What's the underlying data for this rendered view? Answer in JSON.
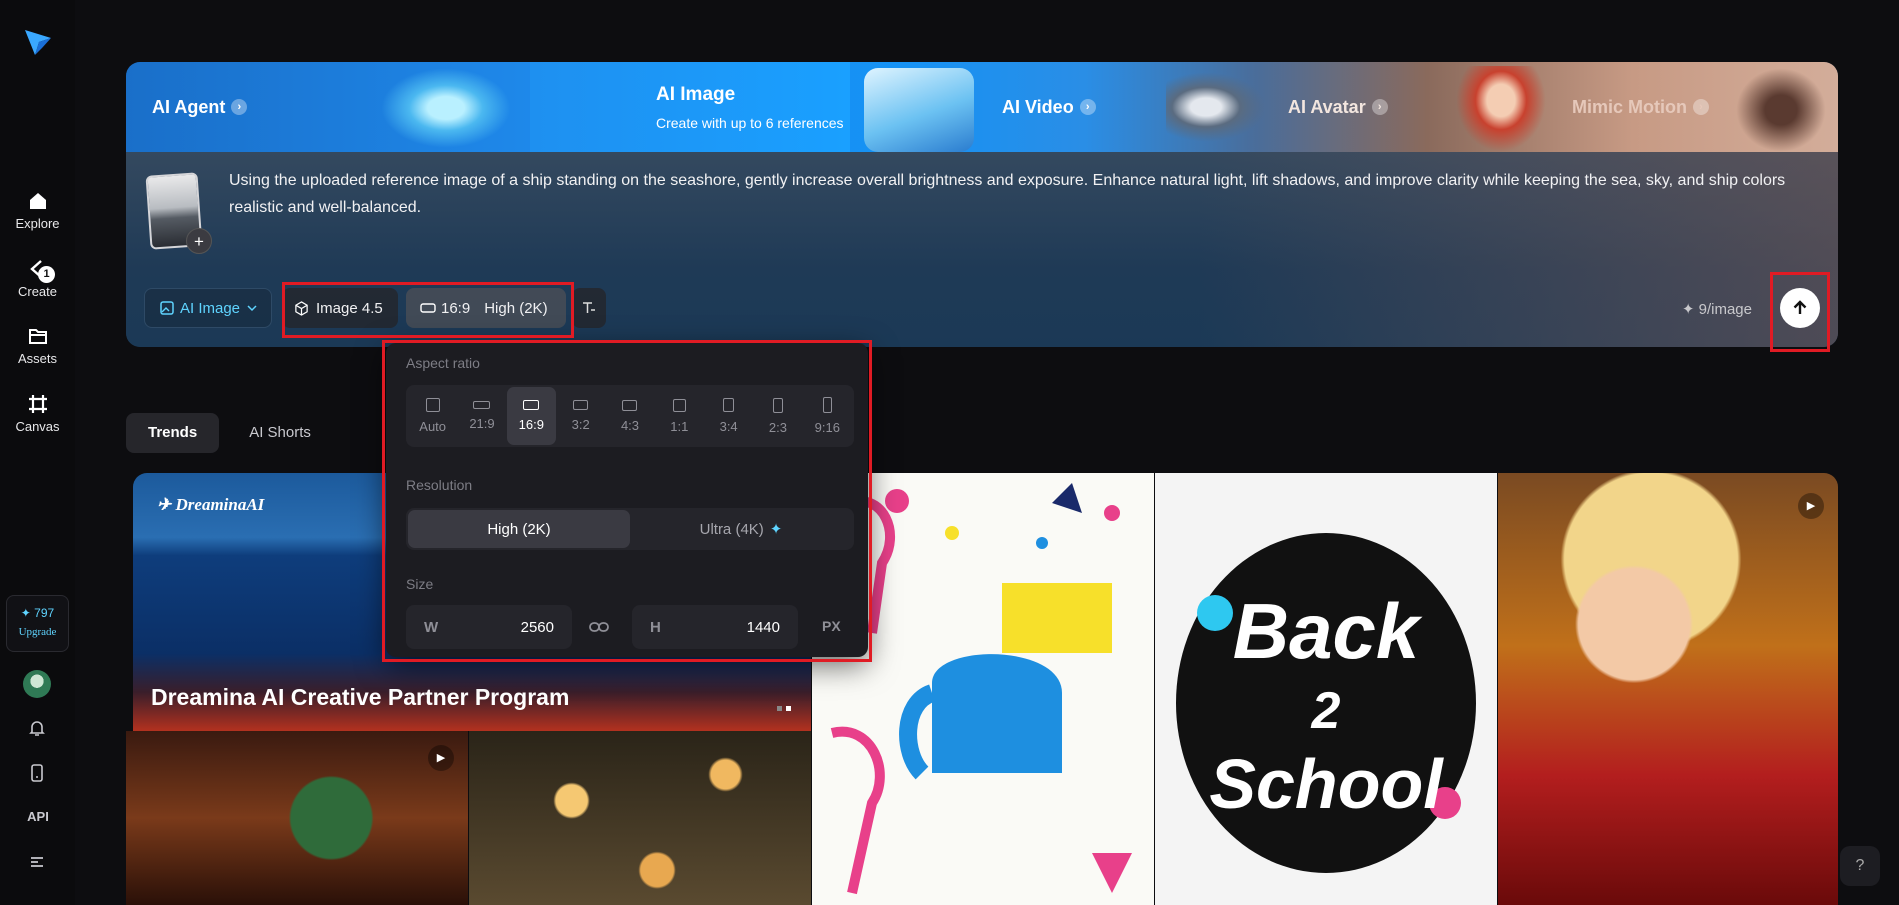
{
  "sidebar": {
    "items": [
      {
        "label": "Explore",
        "icon": "home-icon"
      },
      {
        "label": "Create",
        "icon": "create-icon",
        "badge": "1"
      },
      {
        "label": "Assets",
        "icon": "folder-icon"
      },
      {
        "label": "Canvas",
        "icon": "canvas-icon"
      }
    ],
    "credits": "✦ 797",
    "upgrade": "Upgrade",
    "api": "API"
  },
  "hero": {
    "tabs": {
      "agent": "AI Agent",
      "image_title": "AI Image",
      "image_sub": "Create with up to 6 references",
      "video": "AI Video",
      "avatar": "AI Avatar",
      "mimic": "Mimic Motion"
    },
    "prompt": "Using the uploaded reference image of a ship standing on the seashore, gently increase overall brightness and exposure. Enhance natural light, lift shadows, and improve clarity while keeping the sea, sky, and ship colors realistic and well-balanced.",
    "controls": {
      "mode": "AI Image",
      "model": "Image 4.5",
      "ratio": "16:9",
      "resolution": "High (2K)"
    },
    "cost": "✦ 9/image"
  },
  "popup": {
    "aspect_label": "Aspect ratio",
    "ratios": [
      "Auto",
      "21:9",
      "16:9",
      "3:2",
      "4:3",
      "1:1",
      "3:4",
      "2:3",
      "9:16"
    ],
    "selected_ratio": "16:9",
    "resolution_label": "Resolution",
    "res_high": "High (2K)",
    "res_ultra": "Ultra (4K)",
    "size_label": "Size",
    "w_label": "W",
    "w_value": "2560",
    "h_label": "H",
    "h_value": "1440",
    "unit": "PX"
  },
  "feed": {
    "tabs": [
      "Trends",
      "AI Shorts"
    ],
    "banner_brand": "DreaminaAI",
    "banner_caption": "Dreamina AI Creative Partner Program"
  },
  "colors": {
    "accent": "#5fd4ff",
    "highlight": "#e01b24"
  }
}
